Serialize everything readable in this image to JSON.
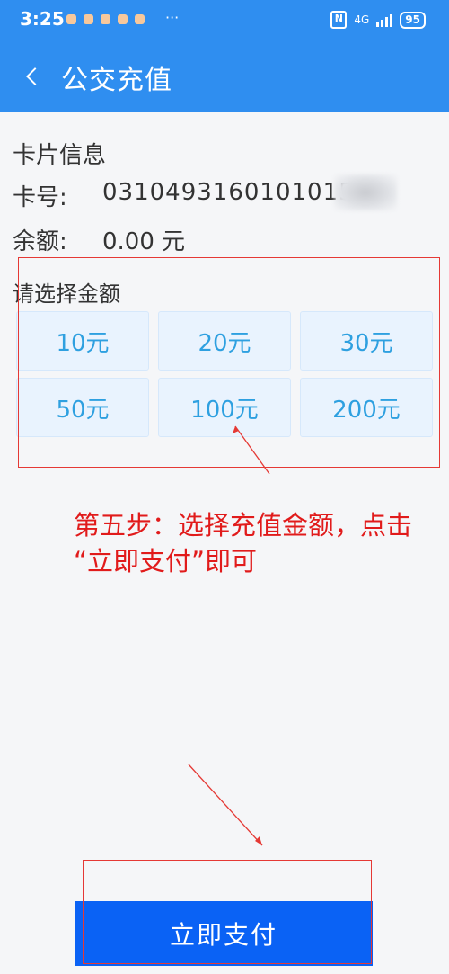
{
  "status_bar": {
    "time": "3:25",
    "battery": "95",
    "network": "4G",
    "more": "···"
  },
  "header": {
    "title": "公交充值"
  },
  "card_info": {
    "section_title": "卡片信息",
    "card_label": "卡号:",
    "card_number": "0310493160101015",
    "balance_label": "余额:",
    "balance_value": "0.00 元"
  },
  "amount_section": {
    "title": "请选择金额",
    "options": [
      "10元",
      "20元",
      "30元",
      "50元",
      "100元",
      "200元"
    ]
  },
  "annotation": {
    "line1": "第五步：选择充值金额，点击",
    "line2": "“立即支付”即可",
    "color": "#e11b1b"
  },
  "pay_button": {
    "label": "立即支付",
    "color": "#0a62f5"
  }
}
